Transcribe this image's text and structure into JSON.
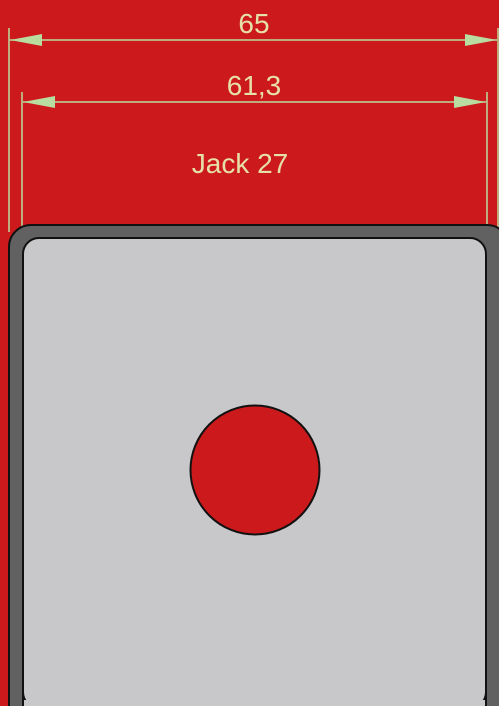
{
  "drawing": {
    "outer_dimension": "65",
    "inner_dimension": "61,3",
    "part_label": "Jack 27"
  },
  "colors": {
    "background": "#cc1a1c",
    "frame": "#616161",
    "plate": "#c8c8ca",
    "hole": "#cc1a1c",
    "dimension_line": "#b9dca0",
    "text": "#e6e0a8",
    "outline": "#111111"
  }
}
